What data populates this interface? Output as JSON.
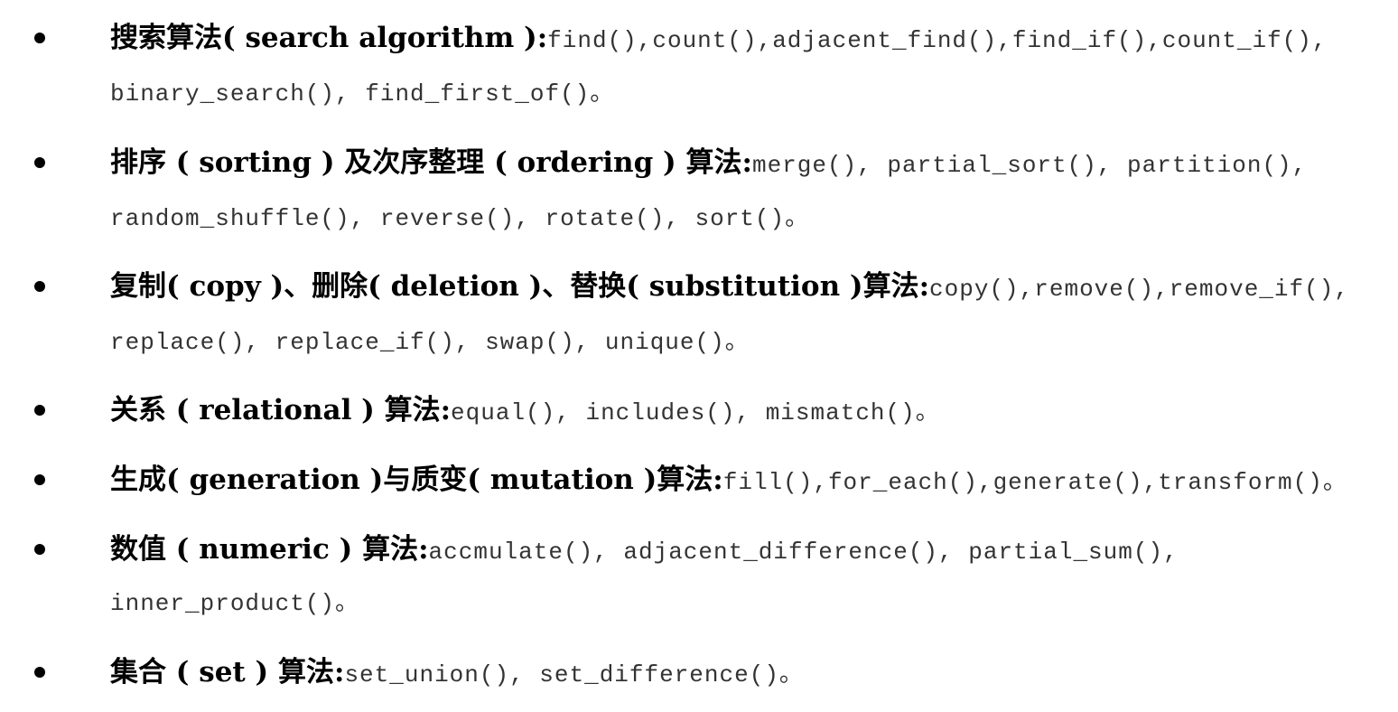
{
  "items": [
    {
      "title": "搜索算法( search algorithm ):",
      "line1": "find(),count(),adjacent_find(),find_if(),count_if(),",
      "line2": "binary_search(), find_first_of()。"
    },
    {
      "title": "排序 ( sorting ) 及次序整理 ( ordering ) 算法:",
      "line1": "merge(), partial_sort(), partition(),",
      "line2": "random_shuffle(), reverse(), rotate(), sort()。"
    },
    {
      "title": "复制( copy )、删除( deletion )、替换( substitution )算法:",
      "line1": "copy(),remove(),remove_if(),",
      "line2": "replace(), replace_if(), swap(), unique()。"
    },
    {
      "title": "关系 ( relational ) 算法:",
      "line1": "equal(), includes(), mismatch()。",
      "line2": ""
    },
    {
      "title": "生成( generation )与质变( mutation )算法:",
      "line1": "fill(),for_each(),generate(),transform()。",
      "line2": ""
    },
    {
      "title": "数值 ( numeric ) 算法:",
      "line1": "accmulate(), adjacent_difference(), partial_sum(),",
      "line2": "inner_product()。"
    },
    {
      "title": "集合 ( set ) 算法:",
      "line1": "set_union(), set_difference()。",
      "line2": ""
    }
  ]
}
